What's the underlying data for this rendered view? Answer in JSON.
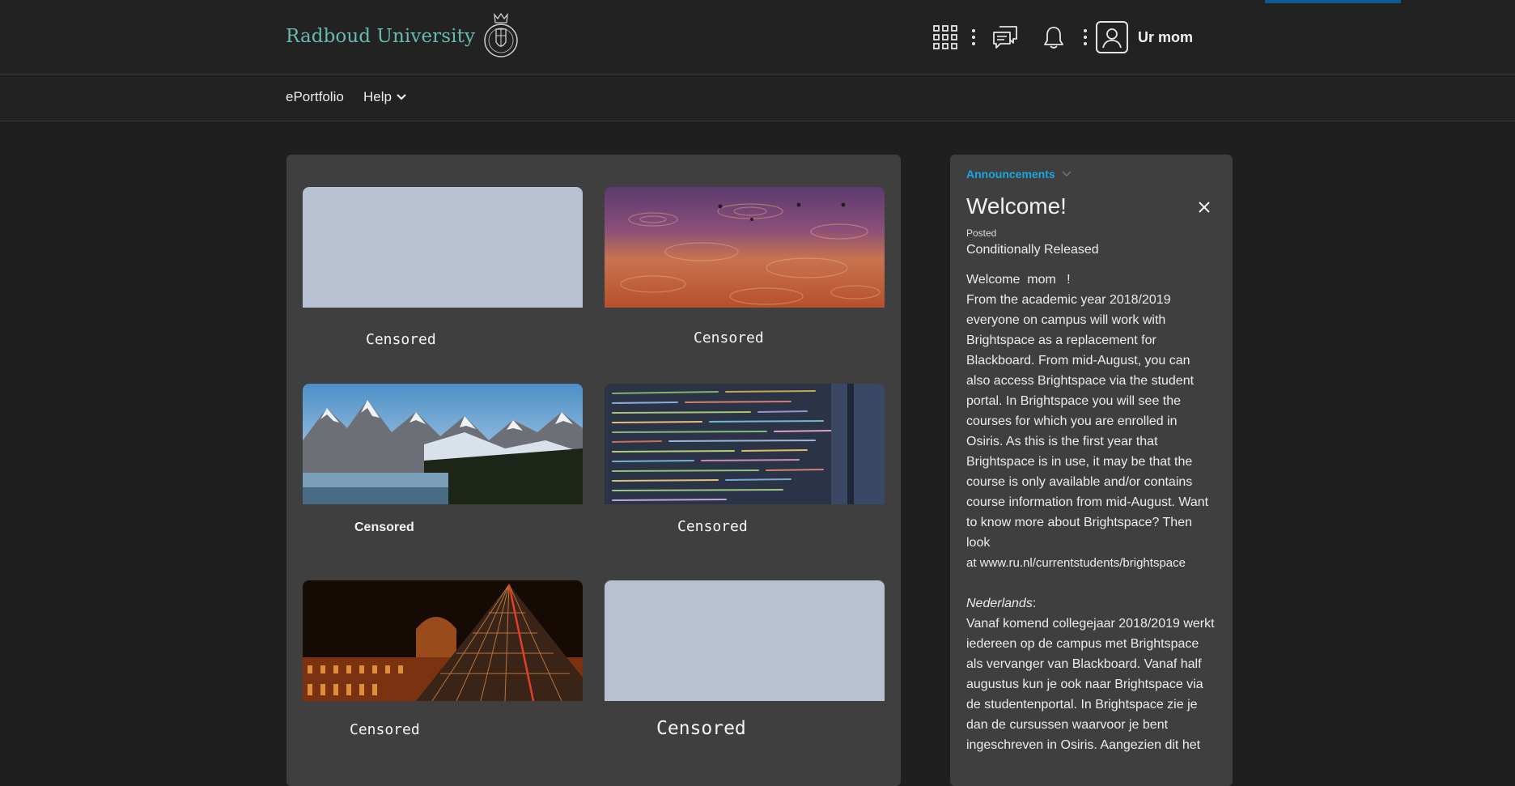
{
  "header": {
    "university_name": "Radboud University",
    "user_name": "Ur mom",
    "icons": [
      "apps-grid-icon",
      "more-vertical-icon",
      "message-alerts-icon",
      "notification-bell-icon",
      "more-vertical-icon",
      "user-avatar-icon"
    ]
  },
  "nav": {
    "items": [
      {
        "label": "ePortfolio"
      },
      {
        "label": "Help"
      }
    ]
  },
  "courses": [
    {
      "label": "Censored",
      "image": "blank"
    },
    {
      "label": "Censored",
      "image": "water-ripples-sunset"
    },
    {
      "label": "Censored",
      "image": "mountain-lake"
    },
    {
      "label": "Censored",
      "image": "code-screen"
    },
    {
      "label": "Censored",
      "image": "louvre-pyramid-night"
    },
    {
      "label": "Censored",
      "image": "blank"
    }
  ],
  "announcements": {
    "widget_label": "Announcements",
    "title": "Welcome!",
    "posted_label": "Posted",
    "status": "Conditionally Released",
    "greeting": "Welcome  mom   !",
    "english_text": "From the academic year 2018/2019 everyone on campus will work with Brightspace as a replacement for Blackboard. From mid-August, you can also access Brightspace via the student portal. In Brightspace you will see the courses for which you are enrolled in Osiris. As this is the first year that Brightspace is in use, it may be that the course is only available and/or contains course information from mid-August. Want to know more about Brightspace? Then look",
    "link_line": "at www.ru.nl/currentstudents/brightspace",
    "dutch_heading": "Nederlands",
    "dutch_text": "Vanaf komend collegejaar 2018/2019 werkt iedereen op de campus met Brightspace als vervanger van Blackboard. Vanaf half augustus kun je  ook naar Brightspace via de studentenportal. In Brightspace zie je dan de cursussen waarvoor je bent ingeschreven in Osiris. Aangezien dit het"
  },
  "colors": {
    "background": "#1f1f1f",
    "bar": "#222222",
    "panel": "#3f3f3f",
    "accent_teal": "#68b9b0",
    "link_blue": "#1aa6e0",
    "placeholder": "#b8c1d1"
  }
}
